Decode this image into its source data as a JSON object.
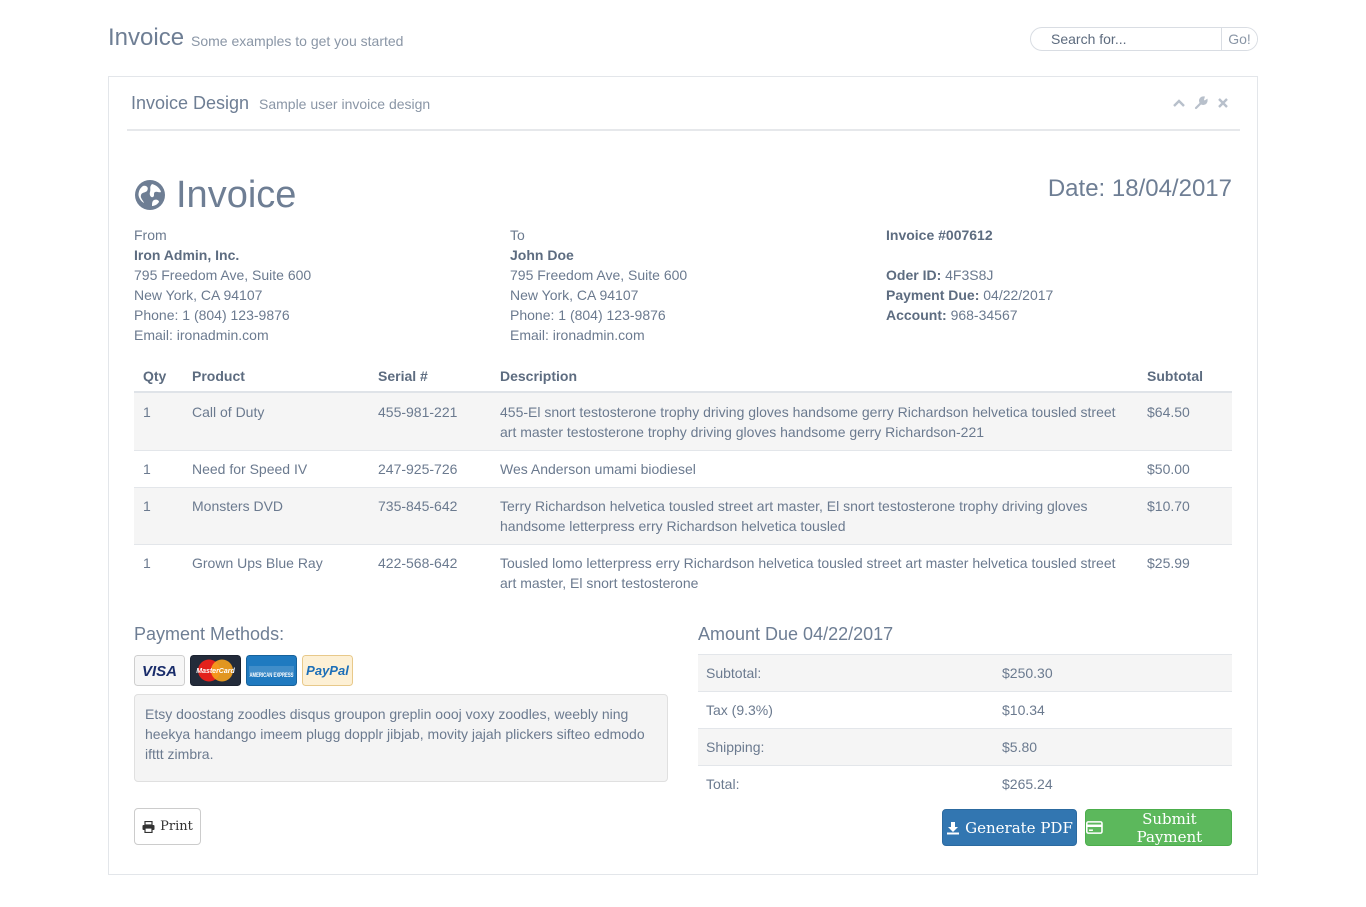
{
  "header": {
    "title": "Invoice",
    "subtitle": "Some examples to get you started",
    "search": {
      "placeholder": "Search for...",
      "go_label": "Go!"
    }
  },
  "panel": {
    "title": "Invoice Design",
    "subtitle": "Sample user invoice design",
    "tools": [
      "collapse-icon",
      "wrench-icon",
      "close-icon"
    ]
  },
  "invoice": {
    "title": "Invoice",
    "logo_icon": "globe-icon",
    "date": "Date: 18/04/2017",
    "from": {
      "label": "From",
      "name": "Iron Admin, Inc.",
      "street": "795 Freedom Ave, Suite 600",
      "city": "New York, CA 94107",
      "phone": "Phone: 1 (804) 123-9876",
      "email": "Email: ironadmin.com"
    },
    "to": {
      "label": "To",
      "name": "John Doe",
      "street": "795 Freedom Ave, Suite 600",
      "city": "New York, CA 94107",
      "phone": "Phone: 1 (804) 123-9876",
      "email": "Email: ironadmin.com"
    },
    "meta": {
      "number": "Invoice #007612",
      "order_label": "Oder ID:",
      "order_value": "4F3S8J",
      "payment_due_label": "Payment Due:",
      "payment_due_value": "04/22/2017",
      "account_label": "Account:",
      "account_value": "968-34567"
    }
  },
  "items": {
    "columns": [
      "Qty",
      "Product",
      "Serial #",
      "Description",
      "Subtotal"
    ],
    "rows": [
      {
        "qty": "1",
        "product": "Call of Duty",
        "serial": "455-981-221",
        "description": "455-El snort testosterone trophy driving gloves handsome gerry Richardson helvetica tousled street art master testosterone trophy driving gloves handsome gerry Richardson-221",
        "subtotal": "$64.50"
      },
      {
        "qty": "1",
        "product": "Need for Speed IV",
        "serial": "247-925-726",
        "description": "Wes Anderson umami biodiesel",
        "subtotal": "$50.00"
      },
      {
        "qty": "1",
        "product": "Monsters DVD",
        "serial": "735-845-642",
        "description": "Terry Richardson helvetica tousled street art master, El snort testosterone trophy driving gloves handsome letterpress erry Richardson helvetica tousled",
        "subtotal": "$10.70"
      },
      {
        "qty": "1",
        "product": "Grown Ups Blue Ray",
        "serial": "422-568-642",
        "description": "Tousled lomo letterpress erry Richardson helvetica tousled street art master helvetica tousled street art master, El snort testosterone",
        "subtotal": "$25.99"
      }
    ]
  },
  "payment": {
    "title": "Payment Methods:",
    "cards": [
      {
        "name": "visa-icon",
        "text": "VISA"
      },
      {
        "name": "mastercard-icon",
        "text": "MasterCard"
      },
      {
        "name": "amex-icon",
        "text": "AMERICAN EXPRESS"
      },
      {
        "name": "paypal-icon",
        "text": "PayPal"
      }
    ],
    "note": "Etsy doostang zoodles disqus groupon greplin oooj voxy zoodles, weebly ning heekya handango imeem plugg dopplr jibjab, movity jajah plickers sifteo edmodo ifttt zimbra."
  },
  "amount_due": {
    "title": "Amount Due 04/22/2017",
    "rows": [
      {
        "label": "Subtotal:",
        "value": "$250.30"
      },
      {
        "label": "Tax (9.3%)",
        "value": "$10.34"
      },
      {
        "label": "Shipping:",
        "value": "$5.80"
      },
      {
        "label": "Total:",
        "value": "$265.24"
      }
    ]
  },
  "actions": {
    "print": "Print",
    "generate_pdf": "Generate PDF",
    "submit_payment": "Submit Payment"
  },
  "colors": {
    "primary": "#3276b1",
    "success": "#5cb85c",
    "heading": "#6e7e94"
  }
}
